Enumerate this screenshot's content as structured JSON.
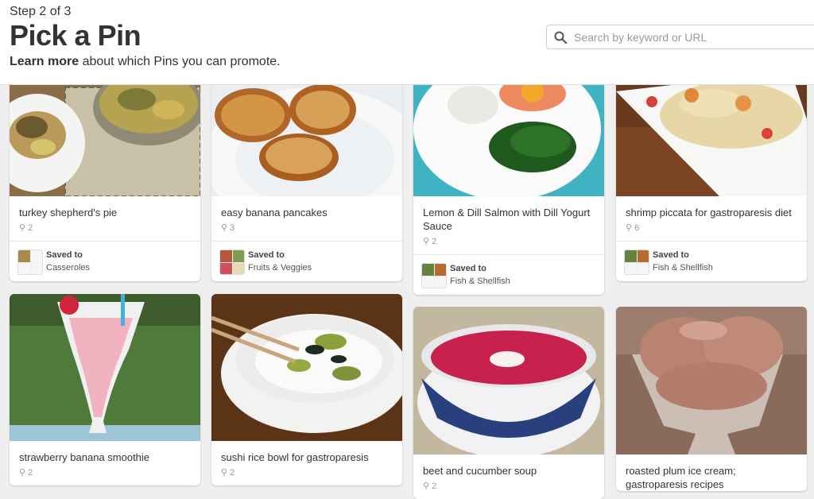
{
  "header": {
    "step": "Step 2 of 3",
    "title": "Pick a Pin",
    "learn_link": "Learn more",
    "learn_rest": " about which Pins you can promote."
  },
  "search": {
    "placeholder": "Search by keyword or URL"
  },
  "pins": [
    {
      "caption": "turkey shepherd's pie",
      "repins": "2",
      "saved_label": "Saved to",
      "board": "Casseroles"
    },
    {
      "caption": "easy banana pancakes",
      "repins": "3",
      "saved_label": "Saved to",
      "board": "Fruits & Veggies"
    },
    {
      "caption": "Lemon & Dill Salmon with Dill Yogurt Sauce",
      "repins": "2",
      "saved_label": "Saved to",
      "board": "Fish & Shellfish"
    },
    {
      "caption": "shrimp piccata for gastroparesis diet",
      "repins": "6",
      "saved_label": "Saved to",
      "board": "Fish & Shellfish"
    },
    {
      "caption": "strawberry banana smoothie",
      "repins": "2"
    },
    {
      "caption": "sushi rice bowl for gastroparesis",
      "repins": "2"
    },
    {
      "caption": "beet and cucumber soup",
      "repins": "2"
    },
    {
      "caption": "roasted plum ice cream; gastroparesis recipes"
    }
  ]
}
